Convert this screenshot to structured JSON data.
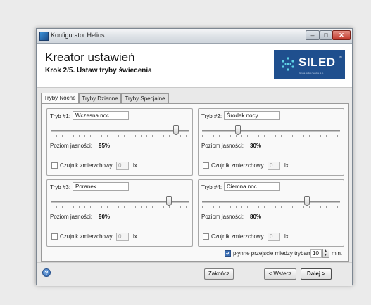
{
  "window": {
    "title": "Konfigurator Helios",
    "controls": {
      "minimize": "–",
      "maximize": "□",
      "close": "✕"
    }
  },
  "header": {
    "title": "Kreator ustawień",
    "subtitle": "Krok 2/5. Ustaw tryby świecenia",
    "logo_text": "SILED",
    "logo_registered": "®",
    "logo_tagline": "Grupa Helios Service S.A."
  },
  "tabs": [
    {
      "label": "Tryby Nocne",
      "active": true
    },
    {
      "label": "Tryby Dzienne",
      "active": false
    },
    {
      "label": "Tryby Specjalne",
      "active": false
    }
  ],
  "modes": [
    {
      "label": "Tryb #1:",
      "name": "Wczesna noc",
      "brightness_label": "Poziom jasności:",
      "brightness": "95%",
      "slider_fraction": 0.95,
      "sensor_label": "Czujnik zmierzchowy",
      "sensor_checked": false,
      "lux_value": "0",
      "unit": "lx"
    },
    {
      "label": "Tryb #2:",
      "name": "Środek nocy",
      "brightness_label": "Poziom jasności:",
      "brightness": "30%",
      "slider_fraction": 0.3,
      "sensor_label": "Czujnik zmierzchowy",
      "sensor_checked": false,
      "lux_value": "0",
      "unit": "lx"
    },
    {
      "label": "Tryb #3:",
      "name": "Poranek",
      "brightness_label": "Poziom jasności:",
      "brightness": "90%",
      "slider_fraction": 0.9,
      "sensor_label": "Czujnik zmierzchowy",
      "sensor_checked": false,
      "lux_value": "0",
      "unit": "lx"
    },
    {
      "label": "Tryb #4:",
      "name": "Ciemna noc",
      "brightness_label": "Poziom jasności:",
      "brightness": "80%",
      "slider_fraction": 0.8,
      "sensor_label": "Czujnik zmierzchowy",
      "sensor_checked": false,
      "lux_value": "0",
      "unit": "lx"
    }
  ],
  "transition": {
    "label": "płynne przejscie miedzy trybami",
    "checked": true,
    "value": "10",
    "unit": "min."
  },
  "footer": {
    "help_icon": "?",
    "finish_label": "Zakończ",
    "back_label": "< Wstecz",
    "next_label": "Dalej >"
  },
  "colors": {
    "logo_background": "#1f4f8e",
    "checkbox_checked": "#3c6fb4"
  }
}
